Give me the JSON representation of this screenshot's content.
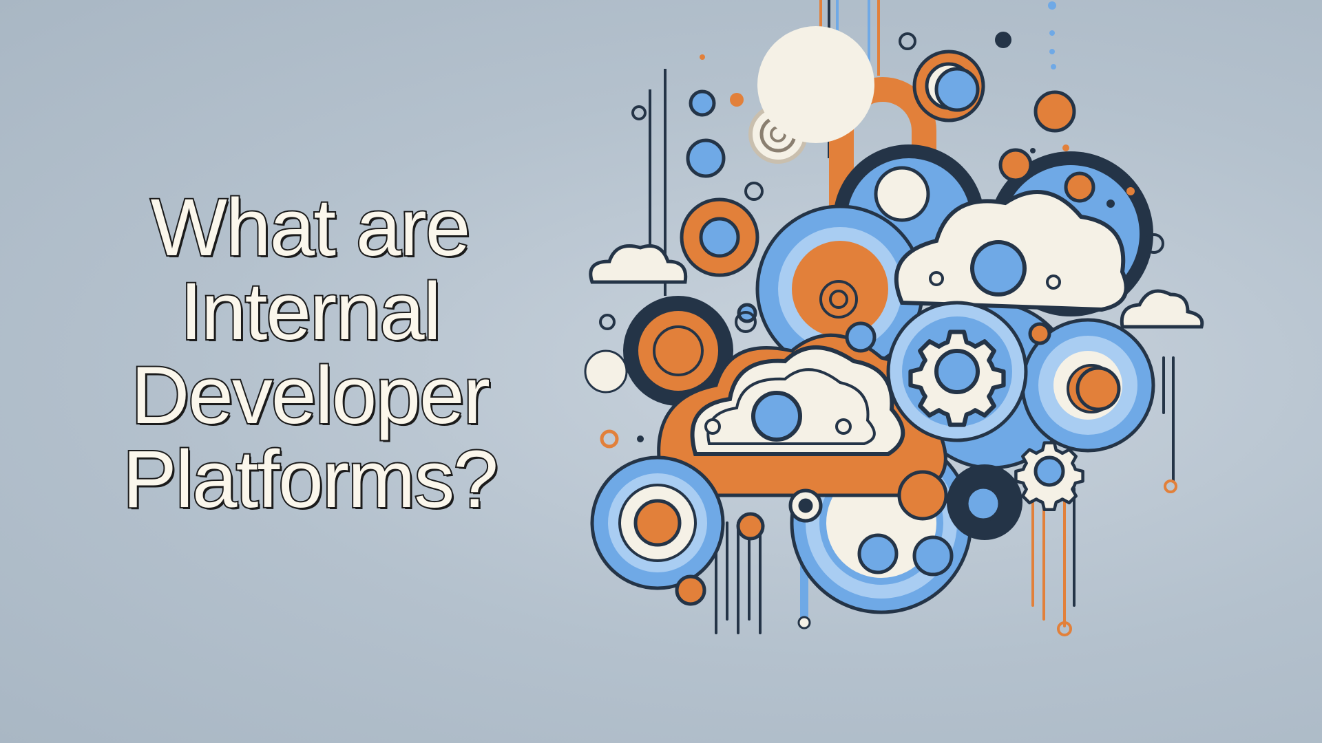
{
  "headline": {
    "line1": "What are",
    "line2": "Internal",
    "line3": "Developer",
    "line4": "Platforms?"
  },
  "illustration": {
    "subject": "cloud-and-gear-abstract-illustration",
    "icons": [
      "cloud-icon",
      "gear-icon",
      "target-icon",
      "circle-node-icon"
    ]
  },
  "colors": {
    "background": "#b8c5d1",
    "orange": "#e2803a",
    "blue": "#6fa9e6",
    "light_blue": "#a9cdf2",
    "navy": "#243447",
    "cream": "#f5f1e6"
  }
}
